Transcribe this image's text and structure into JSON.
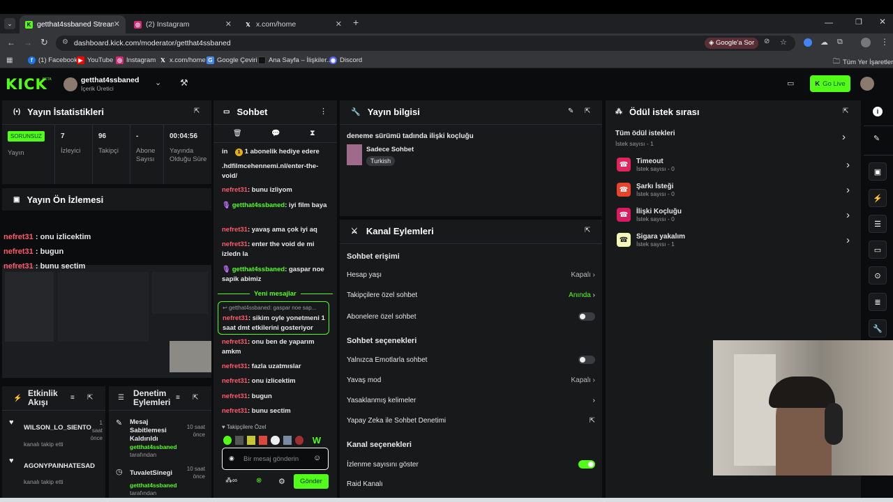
{
  "browser": {
    "tabs": [
      {
        "title": "getthat4ssbaned Stream - Kick"
      },
      {
        "title": "(2) Instagram"
      },
      {
        "title": "x.com/home"
      }
    ],
    "url": "dashboard.kick.com/moderator/getthat4ssbaned",
    "google_sor": "Google'a Sor",
    "bookmarks": [
      "(1) Facebook",
      "YouTube",
      "Instagram",
      "x.com/home",
      "Google Çeviri",
      "Ana Sayfa – İlişkiler...",
      "Discord"
    ],
    "all_bookmarks": "Tüm Yer İşaretleri"
  },
  "kick": {
    "logo": "KICK",
    "beta": "BETA",
    "channel_name": "getthat4ssbaned",
    "channel_role": "İçerik Üretici",
    "go_live": "Go Live"
  },
  "stats": {
    "title": "Yayın İstatistikleri",
    "status_badge": "SORUNSUZ",
    "stream_label": "Yayın",
    "viewers_value": "7",
    "viewers_label": "İzleyici",
    "followers_value": "96",
    "followers_label": "Takipçi",
    "subs_value": "-",
    "subs_label": "Abone Sayısı",
    "duration_value": "00:04:56",
    "duration_label": "Yayında Olduğu Süre"
  },
  "preview": {
    "title": "Yayın Ön İzlemesi",
    "overlay": [
      {
        "user": "nefret31",
        "msg": " : onu izlicektim"
      },
      {
        "user": "nefret31",
        "msg": " : bugun"
      },
      {
        "user": "nefret31",
        "msg": " : bunu sectim"
      }
    ]
  },
  "activity": {
    "title": "Etkinlik Akışı",
    "items": [
      {
        "name": "WILSON_LO_SIENTO",
        "sub": "kanalı takip etti",
        "time": "1 saat önce"
      },
      {
        "name": "AGONYPAINHATESAD",
        "sub": "kanalı takip etti",
        "time": ""
      }
    ]
  },
  "moderation": {
    "title": "Denetim Eylemleri",
    "items": [
      {
        "action": "Mesaj Sabitlemesi Kaldırıldı",
        "by": "getthat4ssbaned",
        "by_suffix": "tarafından",
        "time": "10 saat önce"
      },
      {
        "action": "TuvaletSinegi",
        "by": "getthat4ssbaned",
        "by_suffix": "tarafından",
        "time": "10 saat önce"
      }
    ]
  },
  "chat": {
    "title": "Sohbet",
    "gift_prefix": "in",
    "gift_text": "1 abonelik hediye edere",
    "messages": [
      {
        "user": "",
        "text": ".hdfilmcehennemi.nl/enter-the-void/"
      },
      {
        "user": "nefret31",
        "text": ": bunu izliyom"
      },
      {
        "user": "getthat4ssbaned",
        "text": ": iyi film baya",
        "mod": true
      },
      {
        "user": "nefret31",
        "text": ": yavaş ama çok iyi aq"
      },
      {
        "user": "nefret31",
        "text": ": enter the void de mi izledn la"
      },
      {
        "user": "getthat4ssbaned",
        "text": ": gaspar noe sapik abimiz",
        "mod": true
      }
    ],
    "new_messages": "Yeni mesajlar",
    "reply_context": "getthat4ssbaned: gaspar noe sap...",
    "reply_user": "nefret31",
    "reply_text": ": sikim oyle yonetmeni 1 saat dmt etkilerini gosteriyor",
    "messages2": [
      {
        "user": "nefret31",
        "text": ": onu ben de yaparım amkm"
      },
      {
        "user": "nefret31",
        "text": ": fazla uzatmıslar"
      },
      {
        "user": "nefret31",
        "text": ": onu izlicektim"
      },
      {
        "user": "nefret31",
        "text": ": bugun"
      },
      {
        "user": "nefret31",
        "text": ": bunu sectim"
      }
    ],
    "follower_only": "Takipçilere Özel",
    "input_placeholder": "Bir mesaj gönderin",
    "send": "Gönder"
  },
  "stream_info": {
    "title": "Yayın bilgisi",
    "stream_title": "deneme sürümü tadında ilişki koçluğu",
    "category": "Sadece Sohbet",
    "language": "Turkish"
  },
  "channel_actions": {
    "title": "Kanal Eylemleri",
    "chat_access": "Sohbet erişimi",
    "account_age": "Hesap yaşı",
    "account_age_val": "Kapalı",
    "followers_chat": "Takipçilere özel sohbet",
    "followers_chat_val": "Anında",
    "subs_chat": "Abonelere özel sohbet",
    "chat_options": "Sohbet seçenekleri",
    "emote_only": "Yalnızca Emotlarla sohbet",
    "slow_mode": "Yavaş mod",
    "slow_mode_val": "Kapalı",
    "banned_words": "Yasaklanmış kelimeler",
    "ai_moderation": "Yapay Zeka ile Sohbet Denetimi",
    "channel_options": "Kanal seçenekleri",
    "show_viewers": "İzlenme sayısını göster",
    "raid": "Raid Kanalı"
  },
  "rewards": {
    "title": "Ödül istek sırası",
    "all_title": "Tüm ödül istekleri",
    "all_count": "İstek sayısı - 1",
    "items": [
      {
        "name": "Timeout",
        "count": "İstek sayısı - 0",
        "color": "#e0245e"
      },
      {
        "name": "Şarkı İsteği",
        "count": "İstek sayısı - 0",
        "color": "#e8432b"
      },
      {
        "name": "İlişki Koçluğu",
        "count": "İstek sayısı - 0",
        "color": "#d81b60"
      },
      {
        "name": "Sigara yakalım",
        "count": "İstek sayısı - 1",
        "color": "#f5f7b8"
      }
    ]
  },
  "colors": {
    "accent": "#53fc18",
    "username": "#ff5a6b",
    "panel": "#18191b"
  }
}
